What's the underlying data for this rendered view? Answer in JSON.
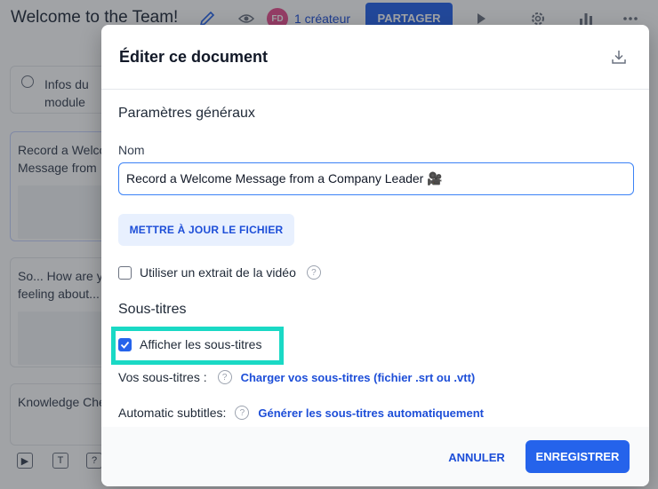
{
  "app": {
    "title": "Welcome to the Team!",
    "avatar_initials": "FD",
    "creators": "1 créateur",
    "share_label": "PARTAGER"
  },
  "sidebar": {
    "info_label": "Infos du module",
    "items": [
      {
        "title": "Record a Welcome Message from"
      },
      {
        "title": "So... How are you feeling about..."
      },
      {
        "title": "Knowledge Che"
      }
    ],
    "bottom_icons": [
      "video-icon",
      "text-icon",
      "question-icon"
    ]
  },
  "modal": {
    "title": "Éditer ce document",
    "general": {
      "heading": "Paramètres généraux",
      "name_label": "Nom",
      "name_value": "Record a Welcome Message from a Company Leader 🎥",
      "update_button": "METTRE À JOUR LE FICHIER",
      "use_excerpt_label": "Utiliser un extrait de la vidéo",
      "use_excerpt_checked": false
    },
    "subtitles": {
      "heading": "Sous-titres",
      "show_label": "Afficher les sous-titres",
      "show_checked": true,
      "your_subtitles_label": "Vos sous-titres :",
      "upload_link": "Charger vos sous-titres (fichier .srt ou .vtt)",
      "auto_label": "Automatic subtitles:",
      "auto_link": "Générer les sous-titres automatiquement"
    },
    "footer": {
      "cancel": "ANNULER",
      "save": "ENREGISTRER"
    }
  },
  "colors": {
    "accent": "#2563eb",
    "link": "#1d4ed8",
    "highlight": "#1ad9c5",
    "avatar": "#e9508f"
  }
}
